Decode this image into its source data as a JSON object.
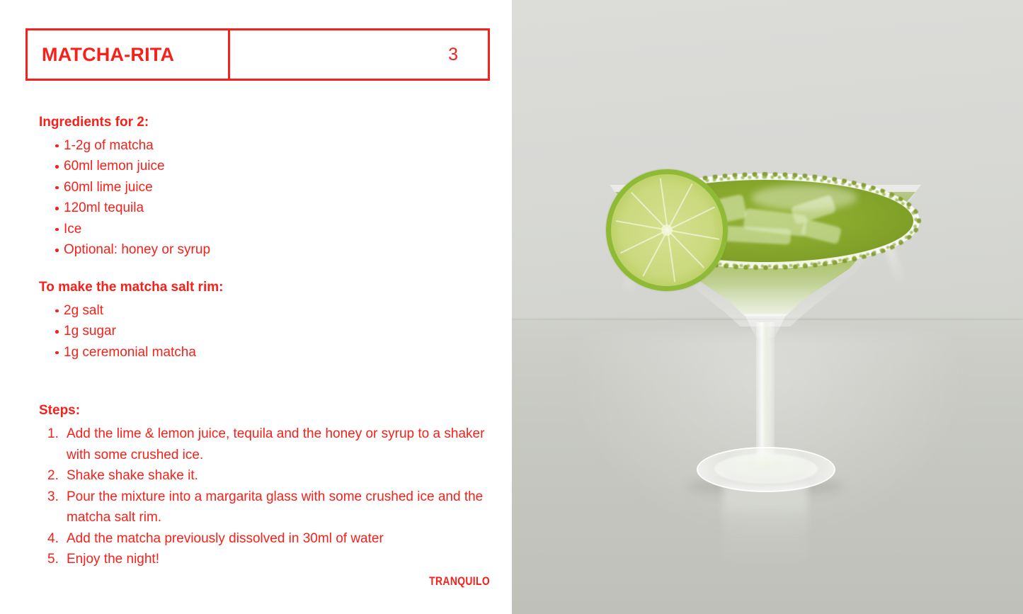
{
  "card": {
    "header": {
      "title": "MATCHA-RITA",
      "number": "3"
    },
    "accent_color": "#f6211a",
    "background_color": "#ffffff",
    "brand": "TRANQUILO",
    "sections": {
      "ingredients": {
        "heading": "Ingredients for 2:",
        "items": [
          "1-2g of matcha",
          "60ml lemon juice",
          "60ml lime juice",
          "120ml tequila",
          "Ice",
          "Optional: honey or syrup"
        ]
      },
      "rim": {
        "heading": "To make the matcha salt rim:",
        "items": [
          "2g salt",
          "1g sugar",
          "1g ceremonial matcha"
        ]
      },
      "steps": {
        "heading": "Steps:",
        "items": [
          "Add the lime & lemon juice, tequila and the honey or syrup to a shaker with some crushed ice.",
          "Shake shake shake it.",
          "Pour the mixture into a margarita glass with some crushed ice and the matcha salt rim.",
          "Add the matcha previously dissolved in 30ml of water",
          "Enjoy the night!"
        ]
      }
    }
  },
  "photo": {
    "subject": "matcha margarita cocktail in a stemmed margarita glass",
    "garnish": "lime wheel",
    "rim": "matcha salt rim",
    "drink_color": "#8fae33",
    "lime_color": "#cbd97e",
    "wall_color": "#d9dad6",
    "table_color": "#c7c8c2"
  }
}
